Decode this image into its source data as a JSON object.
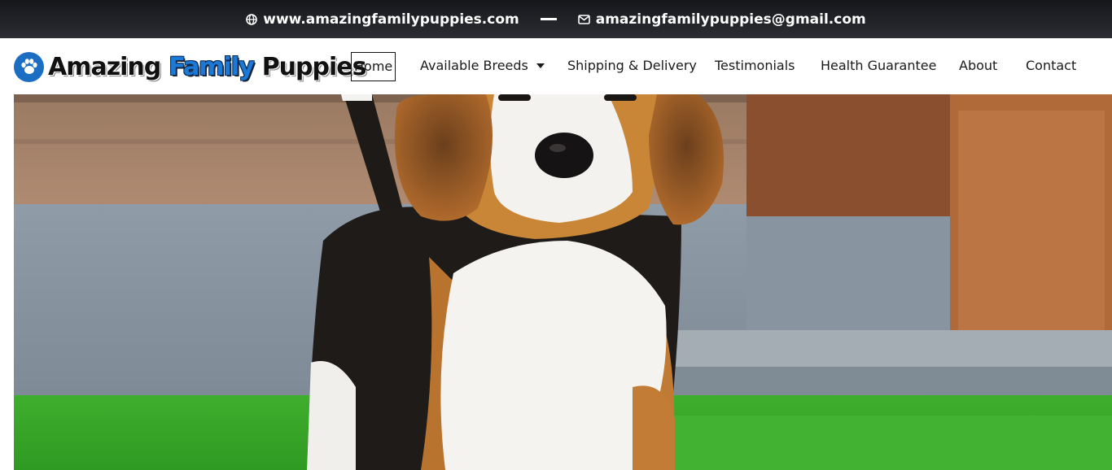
{
  "topbar": {
    "website": "www.amazingfamilypuppies.com",
    "email": "amazingfamilypuppies@gmail.com",
    "icons": [
      "globe-icon",
      "envelope-icon"
    ]
  },
  "logo": {
    "word1": "Amazing",
    "word2": "Family",
    "word3": "Puppies",
    "icon": "paw-icon"
  },
  "nav": {
    "home": "Home",
    "breeds": "Available Breeds",
    "shipping": "Shipping & Delivery",
    "testimonials": "Testimonials",
    "health": "Health Guarantee",
    "about": "About",
    "contact": "Contact"
  },
  "hero": {
    "image": "beagle-puppy-photo"
  },
  "colors": {
    "topbar": "#1e1f23",
    "brand_blue": "#1c7ad6",
    "text": "#1a1a1a"
  }
}
